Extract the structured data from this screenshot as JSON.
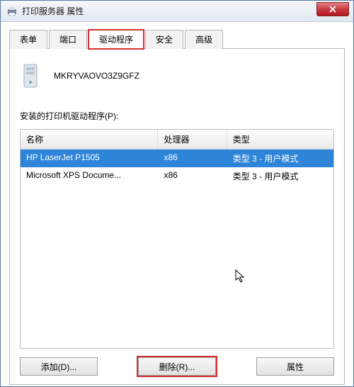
{
  "window": {
    "title": "打印服务器 属性"
  },
  "tabs": {
    "items": [
      {
        "label": "表单",
        "active": false,
        "highlighted": false
      },
      {
        "label": "端口",
        "active": false,
        "highlighted": false
      },
      {
        "label": "驱动程序",
        "active": true,
        "highlighted": true
      },
      {
        "label": "安全",
        "active": false,
        "highlighted": false
      },
      {
        "label": "高级",
        "active": false,
        "highlighted": false
      }
    ]
  },
  "pane": {
    "server_name": "MKRYVAOVO3Z9GFZ",
    "section_label": "安装的打印机驱动程序(P):",
    "columns": {
      "name": "名称",
      "processor": "处理器",
      "type": "类型"
    },
    "drivers": [
      {
        "name": "HP LaserJet P1505",
        "processor": "x86",
        "type": "类型 3 - 用户模式",
        "selected": true
      },
      {
        "name": "Microsoft XPS Docume...",
        "processor": "x86",
        "type": "类型 3 - 用户模式",
        "selected": false
      }
    ],
    "buttons": {
      "add": "添加(D)...",
      "remove": "删除(R)...",
      "properties": "属性"
    }
  }
}
